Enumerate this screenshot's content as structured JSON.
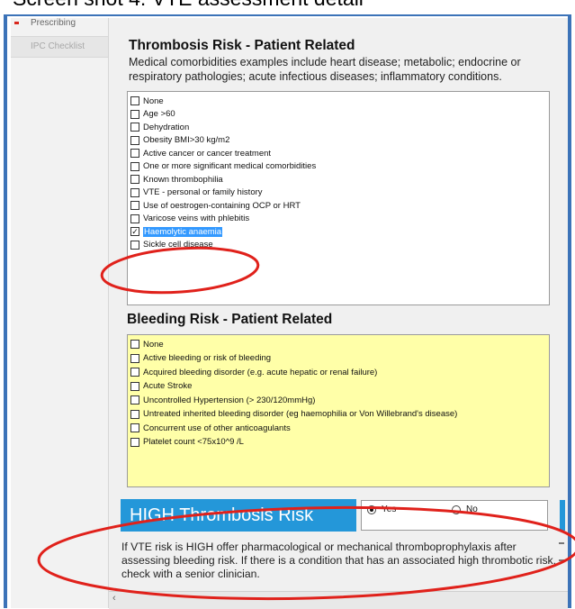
{
  "caption": "Screen shot 4: VTE assessment detail",
  "sidebar": {
    "items": [
      {
        "label": "Prescribing"
      },
      {
        "label": "IPC Checklist"
      }
    ]
  },
  "thrombosis": {
    "title": "Thrombosis Risk - Patient Related",
    "description": "Medical comorbidities examples include heart disease; metabolic; endocrine or respiratory pathologies; acute infectious diseases; inflammatory conditions.",
    "items": [
      {
        "label": "None",
        "checked": false
      },
      {
        "label": "Age >60",
        "checked": false
      },
      {
        "label": "Dehydration",
        "checked": false
      },
      {
        "label": "Obesity BMI>30 kg/m2",
        "checked": false
      },
      {
        "label": "Active cancer or cancer treatment",
        "checked": false
      },
      {
        "label": "One or more significant medical comorbidities",
        "checked": false
      },
      {
        "label": "Known thrombophilia",
        "checked": false
      },
      {
        "label": "VTE - personal or family history",
        "checked": false
      },
      {
        "label": "Use of oestrogen-containing OCP or HRT",
        "checked": false
      },
      {
        "label": "Varicose veins with phlebitis",
        "checked": false
      },
      {
        "label": "Haemolytic anaemia",
        "checked": true
      },
      {
        "label": "Sickle cell disease",
        "checked": false
      }
    ]
  },
  "bleeding": {
    "title": "Bleeding Risk - Patient Related",
    "items": [
      {
        "label": "None",
        "checked": false
      },
      {
        "label": "Active bleeding or risk of bleeding",
        "checked": false
      },
      {
        "label": "Acquired bleeding disorder (e.g. acute hepatic or renal failure)",
        "checked": false
      },
      {
        "label": "Acute Stroke",
        "checked": false
      },
      {
        "label": "Uncontrolled Hypertension (> 230/120mmHg)",
        "checked": false
      },
      {
        "label": "Untreated inherited bleeding disorder (eg haemophilia or Von Willebrand's disease)",
        "checked": false
      },
      {
        "label": "Concurrent use of other anticoagulants",
        "checked": false
      },
      {
        "label": "Platelet count <75x10^9 /L",
        "checked": false
      }
    ]
  },
  "result": {
    "label": "HIGH Thrombosis Risk",
    "yes_label": "Yes",
    "no_label": "No",
    "selected": "Yes",
    "advice": "If VTE risk is HIGH offer pharmacological or mechanical thromboprophylaxis after assessing bleeding risk. If there is a condition that has an associated high thrombotic risk, check with a senior clinician."
  },
  "colors": {
    "accent": "#2497d9",
    "frame": "#3c73b8",
    "annotation": "#e0211b",
    "bleeding_bg": "#ffffa8"
  }
}
